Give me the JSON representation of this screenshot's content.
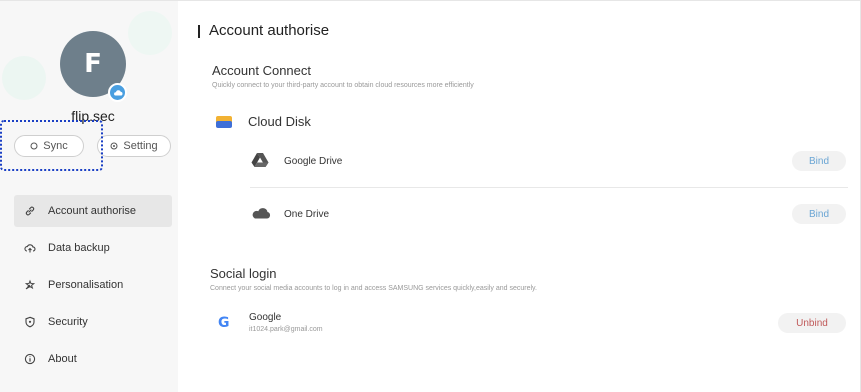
{
  "profile": {
    "initial": "F",
    "username": "flip.sec"
  },
  "sidebar": {
    "sync_label": "Sync",
    "setting_label": "Setting",
    "items": [
      {
        "label": "Account authorise",
        "icon": "link-icon",
        "active": true
      },
      {
        "label": "Data backup",
        "icon": "cloud-upload-icon",
        "active": false
      },
      {
        "label": "Personalisation",
        "icon": "personalisation-icon",
        "active": false
      },
      {
        "label": "Security",
        "icon": "shield-icon",
        "active": false
      },
      {
        "label": "About",
        "icon": "info-icon",
        "active": false
      }
    ]
  },
  "main": {
    "title": "Account authorise",
    "account_connect": {
      "title": "Account Connect",
      "subtitle": "Quickly connect to your third-party account to obtain cloud resources more efficiently",
      "cloud_disk_label": "Cloud Disk",
      "services": [
        {
          "name": "Google Drive",
          "button": "Bind",
          "icon": "google-drive-icon"
        },
        {
          "name": "One Drive",
          "button": "Bind",
          "icon": "onedrive-icon"
        }
      ]
    },
    "social_login": {
      "title": "Social login",
      "subtitle": "Connect your social media accounts to log in and access SAMSUNG services quickly,easily and securely.",
      "accounts": [
        {
          "name": "Google",
          "email": "it1024.park@gmail.com",
          "button": "Unbind",
          "icon": "google-icon"
        }
      ]
    }
  },
  "colors": {
    "bind": "#6aa5d4",
    "unbind": "#c05a5a",
    "avatar": "#6e7f8b",
    "highlight": "#1a3fc4"
  }
}
